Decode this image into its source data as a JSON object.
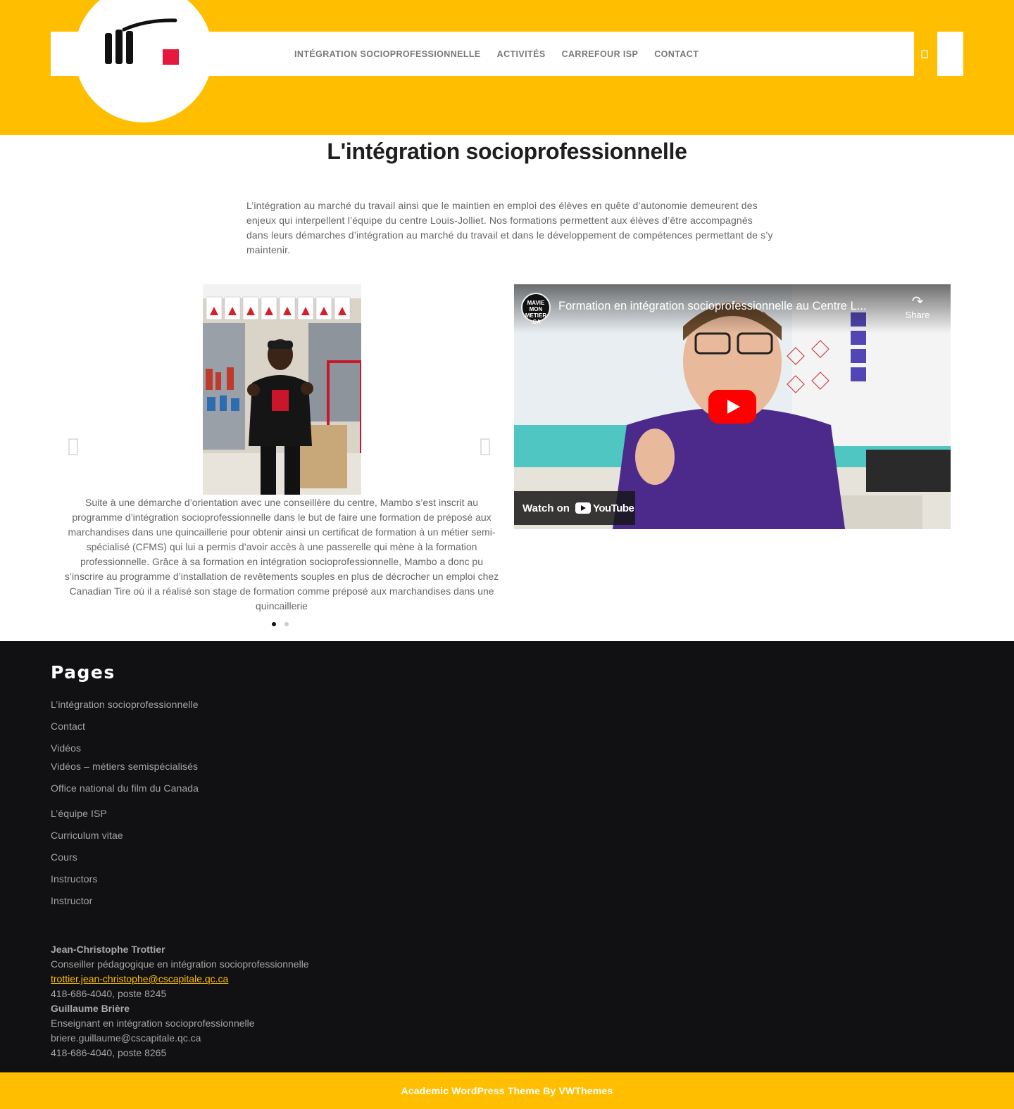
{
  "colors": {
    "accent": "#ffbf00",
    "footer_bg": "#111113",
    "logo_red": "#e6193c"
  },
  "nav": {
    "items": [
      {
        "label": "INTÉGRATION SOCIOPROFESSIONNELLE"
      },
      {
        "label": "ACTIVITÉS"
      },
      {
        "label": "CARREFOUR ISP"
      },
      {
        "label": "CONTACT"
      }
    ],
    "search_icon": "search-icon"
  },
  "main": {
    "title": "L'intégration socioprofessionnelle",
    "intro": "L’intégration au marché du travail ainsi que le maintien en emploi des élèves en quête d’autonomie demeurent des enjeux qui interpellent l’équipe du centre Louis-Jolliet. Nos formations permettent aux élèves d’être accompagnés dans leurs démarches d’intégration au marché du travail et dans le développement de compétences permettant de s’y maintenir.",
    "carousel": {
      "prev_icon": "chevron-left-icon",
      "next_icon": "chevron-right-icon",
      "caption": "Suite à une démarche d’orientation avec une conseillère du centre, Mambo s’est inscrit au programme d’intégration socioprofessionnelle dans le but de faire une formation de préposé aux marchandises dans une quincaillerie pour obtenir ainsi un certificat de formation à un métier semi-spécialisé (CFMS) qui lui a permis d’avoir accès à une passerelle qui mène à la formation professionnelle. Grâce à sa formation en intégration socioprofessionnelle, Mambo a donc pu s’inscrire au programme d’installation de revêtements souples en plus de décrocher un emploi chez Canadian Tire où il a réalisé son stage de formation comme préposé aux marchandises dans une quincaillerie",
      "slide_count": 2,
      "active_slide": 1
    },
    "video": {
      "title": "Formation en intégration socioprofessionnelle au Centre L...",
      "channel": "MAVIE MON METIER .CA",
      "share": "Share",
      "watch_on": "Watch on",
      "youtube": "YouTube"
    }
  },
  "footer": {
    "heading": "Pages",
    "links": [
      "L’intégration socioprofessionnelle",
      "Contact",
      "Vidéos",
      "Vidéos – métiers semispécialisés",
      "Office national du film du Canada",
      "L’équipe ISP",
      "Curriculum vitae",
      "Cours",
      "Instructors",
      "Instructor"
    ],
    "contacts": {
      "person1_name": "Jean-Christophe Trottier",
      "person1_role": "Conseiller pédagogique en intégration socioprofessionnelle",
      "person1_email": "trottier.jean-christophe@cscapitale.qc.ca",
      "person1_phone": "418-686-4040, poste 8245",
      "person2_name": "Guillaume Brière",
      "person2_role": "Enseignant en intégration socioprofessionnelle",
      "person2_email": "briere.guillaume@cscapitale.qc.ca",
      "person2_phone": "418-686-4040, poste 8265"
    },
    "credit": "Academic WordPress Theme By VWThemes"
  }
}
